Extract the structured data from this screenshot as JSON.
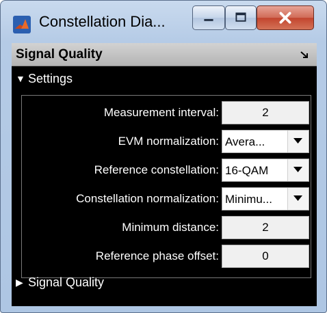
{
  "window": {
    "title": "Constellation Dia...",
    "app_icon": "matlab-icon",
    "buttons": [
      "minimize-icon",
      "maximize-icon",
      "close-icon"
    ]
  },
  "panel": {
    "header": "Signal Quality",
    "undock_icon": "undock-icon",
    "settings_section": {
      "label": "Settings",
      "icon": "expanded-triangle-icon"
    },
    "signal_quality_section": {
      "label": "Signal Quality",
      "icon": "collapsed-triangle-icon"
    }
  },
  "settings": {
    "measurement_interval": {
      "label": "Measurement interval:",
      "value": "2"
    },
    "evm_normalization": {
      "label": "EVM normalization:",
      "value": "Avera..."
    },
    "reference_constellation": {
      "label": "Reference constellation:",
      "value": "16-QAM"
    },
    "constellation_normalization": {
      "label": "Constellation normalization:",
      "value": "Minimu..."
    },
    "minimum_distance": {
      "label": "Minimum distance:",
      "value": "2"
    },
    "reference_phase_offset": {
      "label": "Reference phase offset:",
      "value": "0"
    }
  },
  "colors": {
    "panel_bg": "#000000",
    "header_bg": "#c4c4c4",
    "close_button": "#c7503a"
  }
}
